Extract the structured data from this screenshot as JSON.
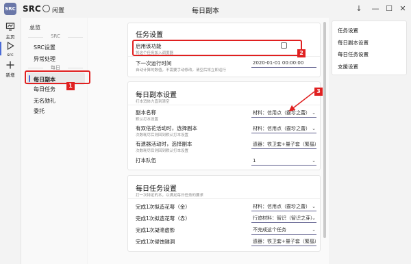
{
  "app": {
    "logo_text": "SRC",
    "name": "SRC",
    "status": "闲置",
    "window_title": "每日副本"
  },
  "window_buttons": [
    "↓",
    "—",
    "☐",
    "✕"
  ],
  "nav": [
    {
      "label": "主页",
      "icon": "monitor-icon"
    },
    {
      "label": "src",
      "icon": "play-icon"
    },
    {
      "label": "新增",
      "icon": "plus-icon"
    }
  ],
  "sidebar": {
    "overview": "总览",
    "src_header": "SRC",
    "src_items": [
      "SRC设置",
      "异常处理"
    ],
    "daily_header": "每日",
    "daily_items": [
      "每日副本",
      "每日任务",
      "无名勋礼",
      "委托"
    ]
  },
  "task_card": {
    "title": "任务设置",
    "enable_label": "启用该功能",
    "enable_desc": "将这个任务加入调度器",
    "next_run_label": "下一次运行时间",
    "next_run_desc": "自动计算的数值，不需要手动修改。清空后将立即运行",
    "next_run_value": "2020-01-01 00:00:00"
  },
  "dungeon_card": {
    "title": "每日副本设置",
    "subtitle": "打本消体力直到清空",
    "rows": [
      {
        "label": "副本名称",
        "desc": "默认打本设置",
        "value": "材料：信用点（霰珍之蕾）"
      },
      {
        "label": "有双倍花活动时，选择副本",
        "desc": "次数耗尽后则回到默认打本设置",
        "value": "材料：信用点（霰珍之蕾）"
      },
      {
        "label": "有遗器活动时，选择副本",
        "desc": "次数耗尽后则回到默认打本设置",
        "value": "遗器：铁卫套+量子套（繁星）"
      },
      {
        "label": "打本队伍",
        "desc": "",
        "value": "1"
      }
    ]
  },
  "daily_card": {
    "title": "每日任务设置",
    "subtitle": "打一次特定的本，以满足每日任务的要求",
    "rows": [
      {
        "label": "完成1次拟造花萼（金）",
        "value": "材料：信用点（霰珍之蕾）"
      },
      {
        "label": "完成1次拟造花萼（赤）",
        "value": "行迹材料：智识（智识之芽）"
      },
      {
        "label": "完成1次凝滞虚影",
        "value": "不完成这个任务"
      },
      {
        "label": "完成1次侵蚀隧洞",
        "value": "遗器：铁卫套+量子套（繁星）"
      }
    ]
  },
  "right_panel": [
    "任务设置",
    "每日副本设置",
    "每日任务设置",
    "支援设置"
  ],
  "annotations": [
    "1",
    "2",
    "3"
  ],
  "colors": {
    "accent": "#4b6bd6",
    "annotation": "#e02020"
  }
}
